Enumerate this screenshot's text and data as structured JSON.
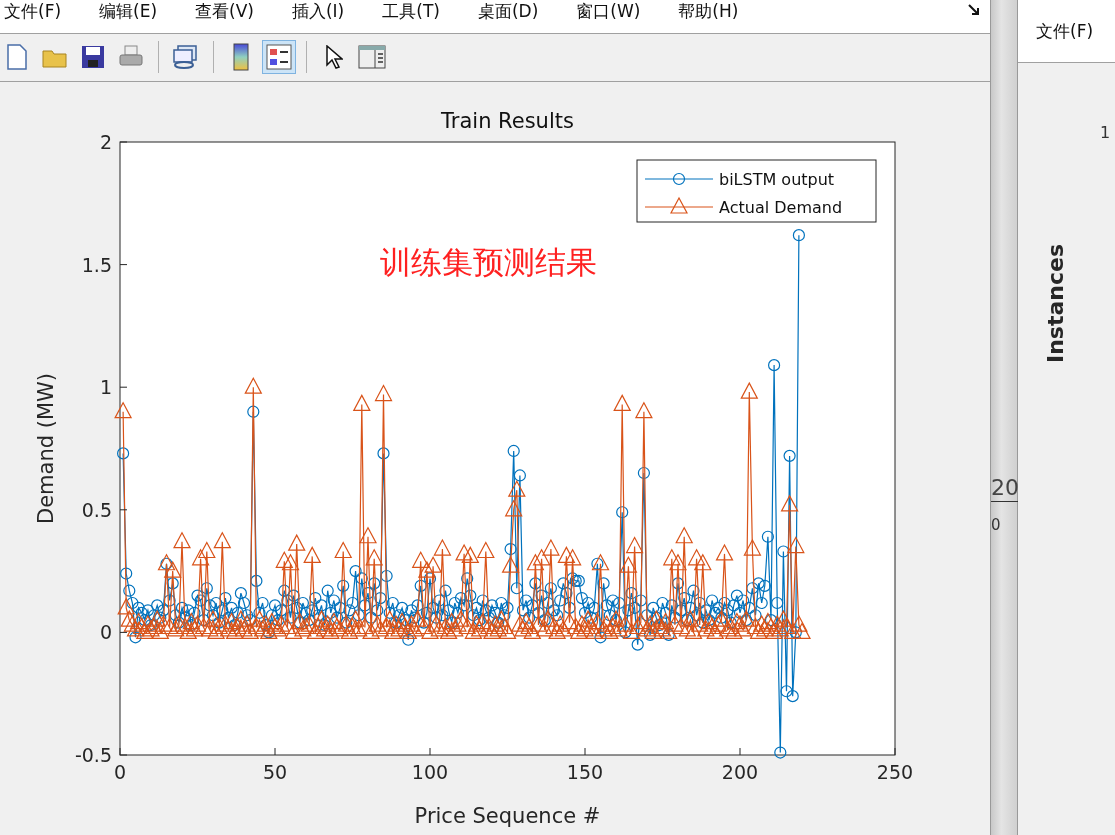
{
  "menu": [
    {
      "label": "文件(F)"
    },
    {
      "label": "编辑(E)"
    },
    {
      "label": "查看(V)"
    },
    {
      "label": "插入(I)"
    },
    {
      "label": "工具(T)"
    },
    {
      "label": "桌面(D)"
    },
    {
      "label": "窗口(W)"
    },
    {
      "label": "帮助(H)"
    }
  ],
  "toolbar": [
    {
      "selected": false
    },
    {
      "selected": false
    },
    {
      "selected": false
    },
    {
      "selected": false
    },
    {
      "selected": false
    },
    {
      "selected": false
    },
    {
      "selected": true
    },
    {
      "selected": false
    },
    {
      "selected": false
    }
  ],
  "figure": {
    "annotation": "训练集预测结果",
    "chart_data": {
      "type": "line",
      "title": "Train Results",
      "xlabel": "Price Sequence #",
      "ylabel": "Demand (MW)",
      "x": [
        1,
        2,
        3,
        4,
        5,
        6,
        7,
        8,
        9,
        10,
        11,
        12,
        13,
        14,
        15,
        16,
        17,
        18,
        19,
        20,
        21,
        22,
        23,
        24,
        25,
        26,
        27,
        28,
        29,
        30,
        31,
        32,
        33,
        34,
        35,
        36,
        37,
        38,
        39,
        40,
        41,
        42,
        43,
        44,
        45,
        46,
        47,
        48,
        49,
        50,
        51,
        52,
        53,
        54,
        55,
        56,
        57,
        58,
        59,
        60,
        61,
        62,
        63,
        64,
        65,
        66,
        67,
        68,
        69,
        70,
        71,
        72,
        73,
        74,
        75,
        76,
        77,
        78,
        79,
        80,
        81,
        82,
        83,
        84,
        85,
        86,
        87,
        88,
        89,
        90,
        91,
        92,
        93,
        94,
        95,
        96,
        97,
        98,
        99,
        100,
        101,
        102,
        103,
        104,
        105,
        106,
        107,
        108,
        109,
        110,
        111,
        112,
        113,
        114,
        115,
        116,
        117,
        118,
        119,
        120,
        121,
        122,
        123,
        124,
        125,
        126,
        127,
        128,
        129,
        130,
        131,
        132,
        133,
        134,
        135,
        136,
        137,
        138,
        139,
        140,
        141,
        142,
        143,
        144,
        145,
        146,
        147,
        148,
        149,
        150,
        151,
        152,
        153,
        154,
        155,
        156,
        157,
        158,
        159,
        160,
        161,
        162,
        163,
        164,
        165,
        166,
        167,
        168,
        169,
        170,
        171,
        172,
        173,
        174,
        175,
        176,
        177,
        178,
        179,
        180,
        181,
        182,
        183,
        184,
        185,
        186,
        187,
        188,
        189,
        190,
        191,
        192,
        193,
        194,
        195,
        196,
        197,
        198,
        199,
        200,
        201,
        202,
        203,
        204,
        205,
        206,
        207,
        208,
        209,
        210,
        211,
        212,
        213,
        214,
        215,
        216,
        217,
        218,
        219,
        220
      ],
      "series": [
        {
          "name": "biLSTM output",
          "color": "#0072bd",
          "marker": "o",
          "values": [
            0.73,
            0.24,
            0.17,
            0.12,
            -0.02,
            0.1,
            0.08,
            0.05,
            0.09,
            0.03,
            0.07,
            0.11,
            0.06,
            0.09,
            0.28,
            0.13,
            0.2,
            0.07,
            0.04,
            0.1,
            0.06,
            0.09,
            0.03,
            0.08,
            0.15,
            0.13,
            0.05,
            0.18,
            0.11,
            0.07,
            0.12,
            0.04,
            0.09,
            0.14,
            0.06,
            0.1,
            0.03,
            0.08,
            0.16,
            0.12,
            0.07,
            0.05,
            0.9,
            0.21,
            0.08,
            0.12,
            0.03,
            0.0,
            0.07,
            0.11,
            0.05,
            0.09,
            0.17,
            0.13,
            0.06,
            0.15,
            0.1,
            0.04,
            0.12,
            0.08,
            0.05,
            0.09,
            0.14,
            0.07,
            0.11,
            0.03,
            0.17,
            0.08,
            0.13,
            0.06,
            0.1,
            0.19,
            0.04,
            0.09,
            0.12,
            0.25,
            0.07,
            0.22,
            0.11,
            0.16,
            0.06,
            0.2,
            0.09,
            0.14,
            0.73,
            0.23,
            0.08,
            0.12,
            0.04,
            0.07,
            0.1,
            0.05,
            -0.03,
            0.09,
            0.06,
            0.11,
            0.19,
            0.04,
            0.08,
            0.22,
            0.1,
            0.06,
            0.13,
            0.07,
            0.17,
            0.09,
            0.04,
            0.12,
            0.08,
            0.14,
            0.11,
            0.22,
            0.15,
            0.07,
            0.1,
            0.05,
            0.13,
            0.09,
            0.06,
            0.11,
            0.08,
            0.04,
            0.12,
            0.07,
            0.1,
            0.34,
            0.74,
            0.18,
            0.64,
            0.09,
            0.13,
            0.06,
            0.11,
            0.2,
            0.08,
            0.15,
            0.05,
            0.12,
            0.18,
            0.09,
            0.07,
            0.13,
            0.2,
            0.16,
            0.1,
            0.22,
            0.21,
            0.21,
            0.14,
            0.08,
            0.12,
            0.06,
            0.1,
            0.28,
            -0.02,
            0.2,
            0.11,
            0.07,
            0.13,
            0.05,
            0.12,
            0.49,
            0.0,
            0.09,
            0.16,
            0.1,
            -0.05,
            0.13,
            0.65,
            0.07,
            -0.01,
            0.1,
            0.06,
            0.03,
            0.12,
            0.08,
            -0.01,
            0.11,
            0.06,
            0.2,
            0.09,
            0.14,
            0.05,
            0.1,
            0.17,
            0.07,
            0.12,
            0.04,
            0.09,
            0.05,
            0.13,
            0.08,
            0.1,
            0.06,
            0.12,
            0.09,
            0.04,
            0.11,
            0.15,
            0.08,
            0.13,
            0.05,
            0.1,
            0.18,
            0.07,
            0.2,
            0.12,
            0.19,
            0.39,
            0.05,
            1.09,
            0.12,
            -0.49,
            0.33,
            -0.24,
            0.72,
            -0.26,
            0.0,
            1.62,
            null
          ]
        },
        {
          "name": "Actual Demand",
          "color": "#d95319",
          "marker": "^",
          "values": [
            0.9,
            0.1,
            0.05,
            0.03,
            0.01,
            0.04,
            0.02,
            0.0,
            0.03,
            0.01,
            0.02,
            0.05,
            0.0,
            0.03,
            0.28,
            0.02,
            0.25,
            0.01,
            0.03,
            0.37,
            0.02,
            0.0,
            0.04,
            0.01,
            0.03,
            0.3,
            0.02,
            0.33,
            0.01,
            0.05,
            0.0,
            0.02,
            0.37,
            0.03,
            0.01,
            0.04,
            0.0,
            0.02,
            0.05,
            0.01,
            0.03,
            0.0,
            1.0,
            0.02,
            0.05,
            0.01,
            0.03,
            0.0,
            0.04,
            0.02,
            0.01,
            0.03,
            0.29,
            0.02,
            0.28,
            0.0,
            0.36,
            0.04,
            0.01,
            0.02,
            0.03,
            0.31,
            0.0,
            0.02,
            0.05,
            0.01,
            0.03,
            0.0,
            0.04,
            0.02,
            0.01,
            0.33,
            0.03,
            0.0,
            0.02,
            0.05,
            0.01,
            0.93,
            0.02,
            0.39,
            0.0,
            0.3,
            0.03,
            0.01,
            0.97,
            0.02,
            0.05,
            0.0,
            0.03,
            0.01,
            0.04,
            0.02,
            0.0,
            0.03,
            0.01,
            0.05,
            0.29,
            0.02,
            0.25,
            0.0,
            0.27,
            0.03,
            0.01,
            0.34,
            0.02,
            0.0,
            0.04,
            0.01,
            0.03,
            0.05,
            0.32,
            0.02,
            0.31,
            0.0,
            0.03,
            0.01,
            0.04,
            0.33,
            0.02,
            0.0,
            0.03,
            0.01,
            0.05,
            0.02,
            0.0,
            0.27,
            0.5,
            0.58,
            0.03,
            0.01,
            0.04,
            0.02,
            0.0,
            0.28,
            0.03,
            0.3,
            0.01,
            0.05,
            0.34,
            0.02,
            0.0,
            0.03,
            0.01,
            0.31,
            0.04,
            0.3,
            0.02,
            0.0,
            0.03,
            0.01,
            0.05,
            0.02,
            0.0,
            0.04,
            0.28,
            0.01,
            0.03,
            0.0,
            0.02,
            0.05,
            0.01,
            0.93,
            0.03,
            0.27,
            0.0,
            0.35,
            0.02,
            0.04,
            0.9,
            0.01,
            0.03,
            0.0,
            0.05,
            0.02,
            0.01,
            0.04,
            0.0,
            0.3,
            0.03,
            0.28,
            0.02,
            0.39,
            0.01,
            0.05,
            0.0,
            0.3,
            0.03,
            0.28,
            0.01,
            0.04,
            0.02,
            0.0,
            0.03,
            0.05,
            0.32,
            0.01,
            0.02,
            0.0,
            0.04,
            0.03,
            0.01,
            0.05,
            0.98,
            0.34,
            0.02,
            0.0,
            0.03,
            0.01,
            0.04,
            0.02,
            0.0,
            0.03,
            0.01,
            0.05,
            0.02,
            0.52,
            0.0,
            0.35,
            0.03,
            0.0
          ]
        }
      ],
      "legend": true,
      "xlim": [
        0,
        250
      ],
      "ylim": [
        -0.5,
        2
      ],
      "xticks": [
        0,
        50,
        100,
        150,
        200,
        250
      ],
      "yticks": [
        -0.5,
        0,
        0.5,
        1,
        1.5,
        2
      ]
    }
  },
  "background_fragments": [
    "20",
    "0"
  ],
  "side_window": {
    "menu": [
      {
        "label": "文件(F)"
      }
    ],
    "tick_fragment": "1",
    "axis_label": "Instances"
  }
}
